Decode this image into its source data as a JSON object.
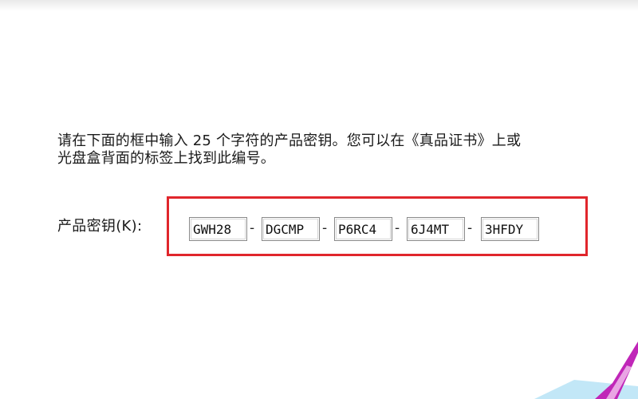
{
  "instruction": {
    "line1": "请在下面的框中输入 25 个字符的产品密钥。您可以在《真品证书》上或",
    "line2": "光盘盒背面的标签上找到此编号。"
  },
  "product_key": {
    "label": "产品密钥(K):",
    "separator": "-",
    "segments": [
      "GWH28",
      "DGCMP",
      "P6RC4",
      "6J4MT",
      "3HFDY"
    ]
  },
  "colors": {
    "highlight": "#e0262c",
    "decor_magenta": "#c026b8",
    "decor_blue": "#8fd3f0"
  }
}
